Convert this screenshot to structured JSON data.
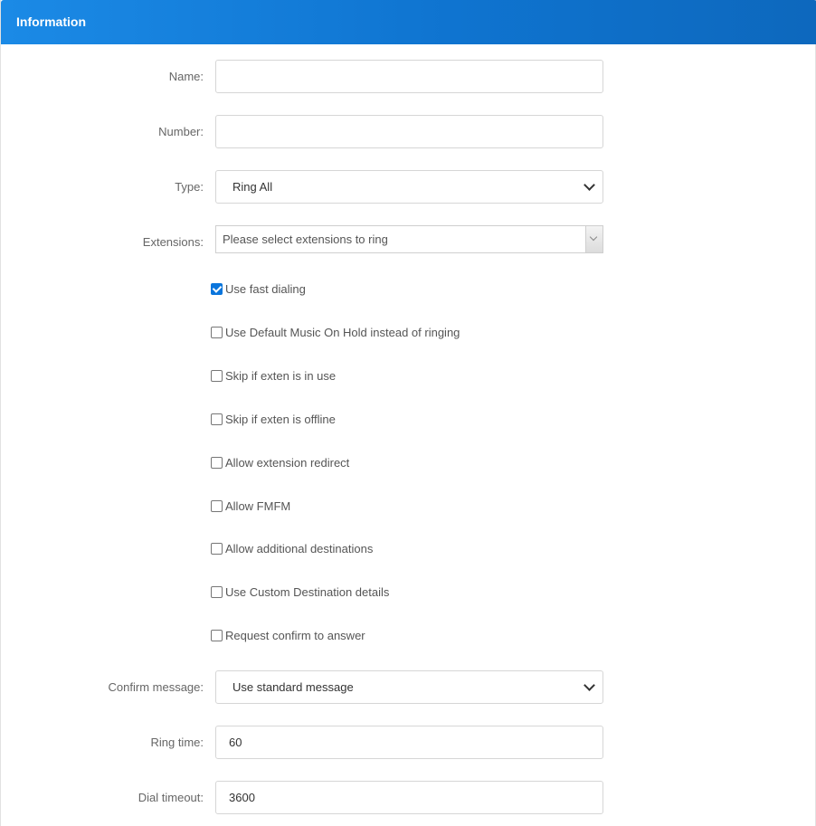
{
  "panel": {
    "title": "Information"
  },
  "form": {
    "name": {
      "label": "Name:",
      "value": ""
    },
    "number": {
      "label": "Number:",
      "value": ""
    },
    "type": {
      "label": "Type:",
      "value": "Ring All"
    },
    "extensions": {
      "label": "Extensions:",
      "placeholder": "Please select extensions to ring"
    },
    "options": [
      {
        "label": "Use fast dialing",
        "checked": true
      },
      {
        "label": "Use Default Music On Hold instead of ringing",
        "checked": false
      },
      {
        "label": "Skip if exten is in use",
        "checked": false
      },
      {
        "label": "Skip if exten is offline",
        "checked": false
      },
      {
        "label": "Allow extension redirect",
        "checked": false
      },
      {
        "label": "Allow FMFM",
        "checked": false
      },
      {
        "label": "Allow additional destinations",
        "checked": false
      },
      {
        "label": "Use Custom Destination details",
        "checked": false
      },
      {
        "label": "Request confirm to answer",
        "checked": false
      }
    ],
    "confirm_message": {
      "label": "Confirm message:",
      "value": "Use standard message"
    },
    "ring_time": {
      "label": "Ring time:",
      "value": "60"
    },
    "dial_timeout": {
      "label": "Dial timeout:",
      "value": "3600"
    }
  },
  "colors": {
    "header_start": "#1b8ae6",
    "header_end": "#0d68bd",
    "checkbox_checked": "#0a75dc"
  }
}
